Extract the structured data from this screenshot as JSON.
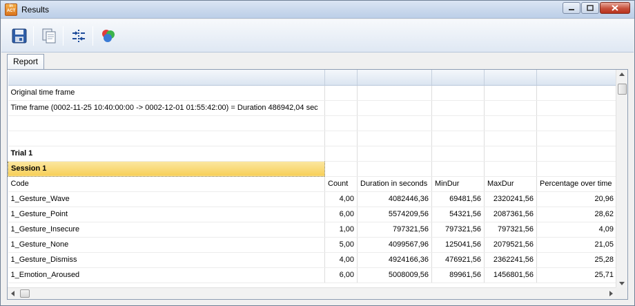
{
  "window": {
    "title": "Results",
    "logo_text": "inter\nact",
    "controls": [
      {
        "name": "minimize",
        "icon": "minimize-icon"
      },
      {
        "name": "maximize",
        "icon": "maximize-icon"
      },
      {
        "name": "close",
        "icon": "close-icon"
      }
    ]
  },
  "toolbar": {
    "buttons": [
      {
        "name": "save",
        "icon": "floppy-disk-icon"
      },
      {
        "name": "copy",
        "icon": "copy-document-icon"
      },
      {
        "name": "columns",
        "icon": "column-split-icon"
      },
      {
        "name": "colors",
        "icon": "color-circles-icon"
      }
    ]
  },
  "tabs": [
    {
      "label": "Report"
    }
  ],
  "report": {
    "info_rows": [
      "Original time frame",
      "Time frame  (0002-11-25 10:40:00:00 -> 0002-12-01 01:55:42:00) = Duration 486942,04 sec"
    ],
    "trial_label": "Trial 1",
    "session_label": "Session 1",
    "columns": [
      "Code",
      "Count",
      "Duration in seconds",
      "MinDur",
      "MaxDur",
      "Percentage over time"
    ],
    "rows": [
      [
        "1_Gesture_Wave",
        "4,00",
        "4082446,36",
        "69481,56",
        "2320241,56",
        "20,96"
      ],
      [
        "1_Gesture_Point",
        "6,00",
        "5574209,56",
        "54321,56",
        "2087361,56",
        "28,62"
      ],
      [
        "1_Gesture_Insecure",
        "1,00",
        "797321,56",
        "797321,56",
        "797321,56",
        "4,09"
      ],
      [
        "1_Gesture_None",
        "5,00",
        "4099567,96",
        "125041,56",
        "2079521,56",
        "21,05"
      ],
      [
        "1_Gesture_Dismiss",
        "4,00",
        "4924166,36",
        "476921,56",
        "2362241,56",
        "25,28"
      ],
      [
        "1_Emotion_Aroused",
        "6,00",
        "5008009,56",
        "89961,56",
        "1456801,56",
        "25,71"
      ]
    ]
  },
  "colors": {
    "session_highlight": "#f7cf58",
    "title_bar": "#c9d8ec",
    "close_button": "#c7503b"
  }
}
